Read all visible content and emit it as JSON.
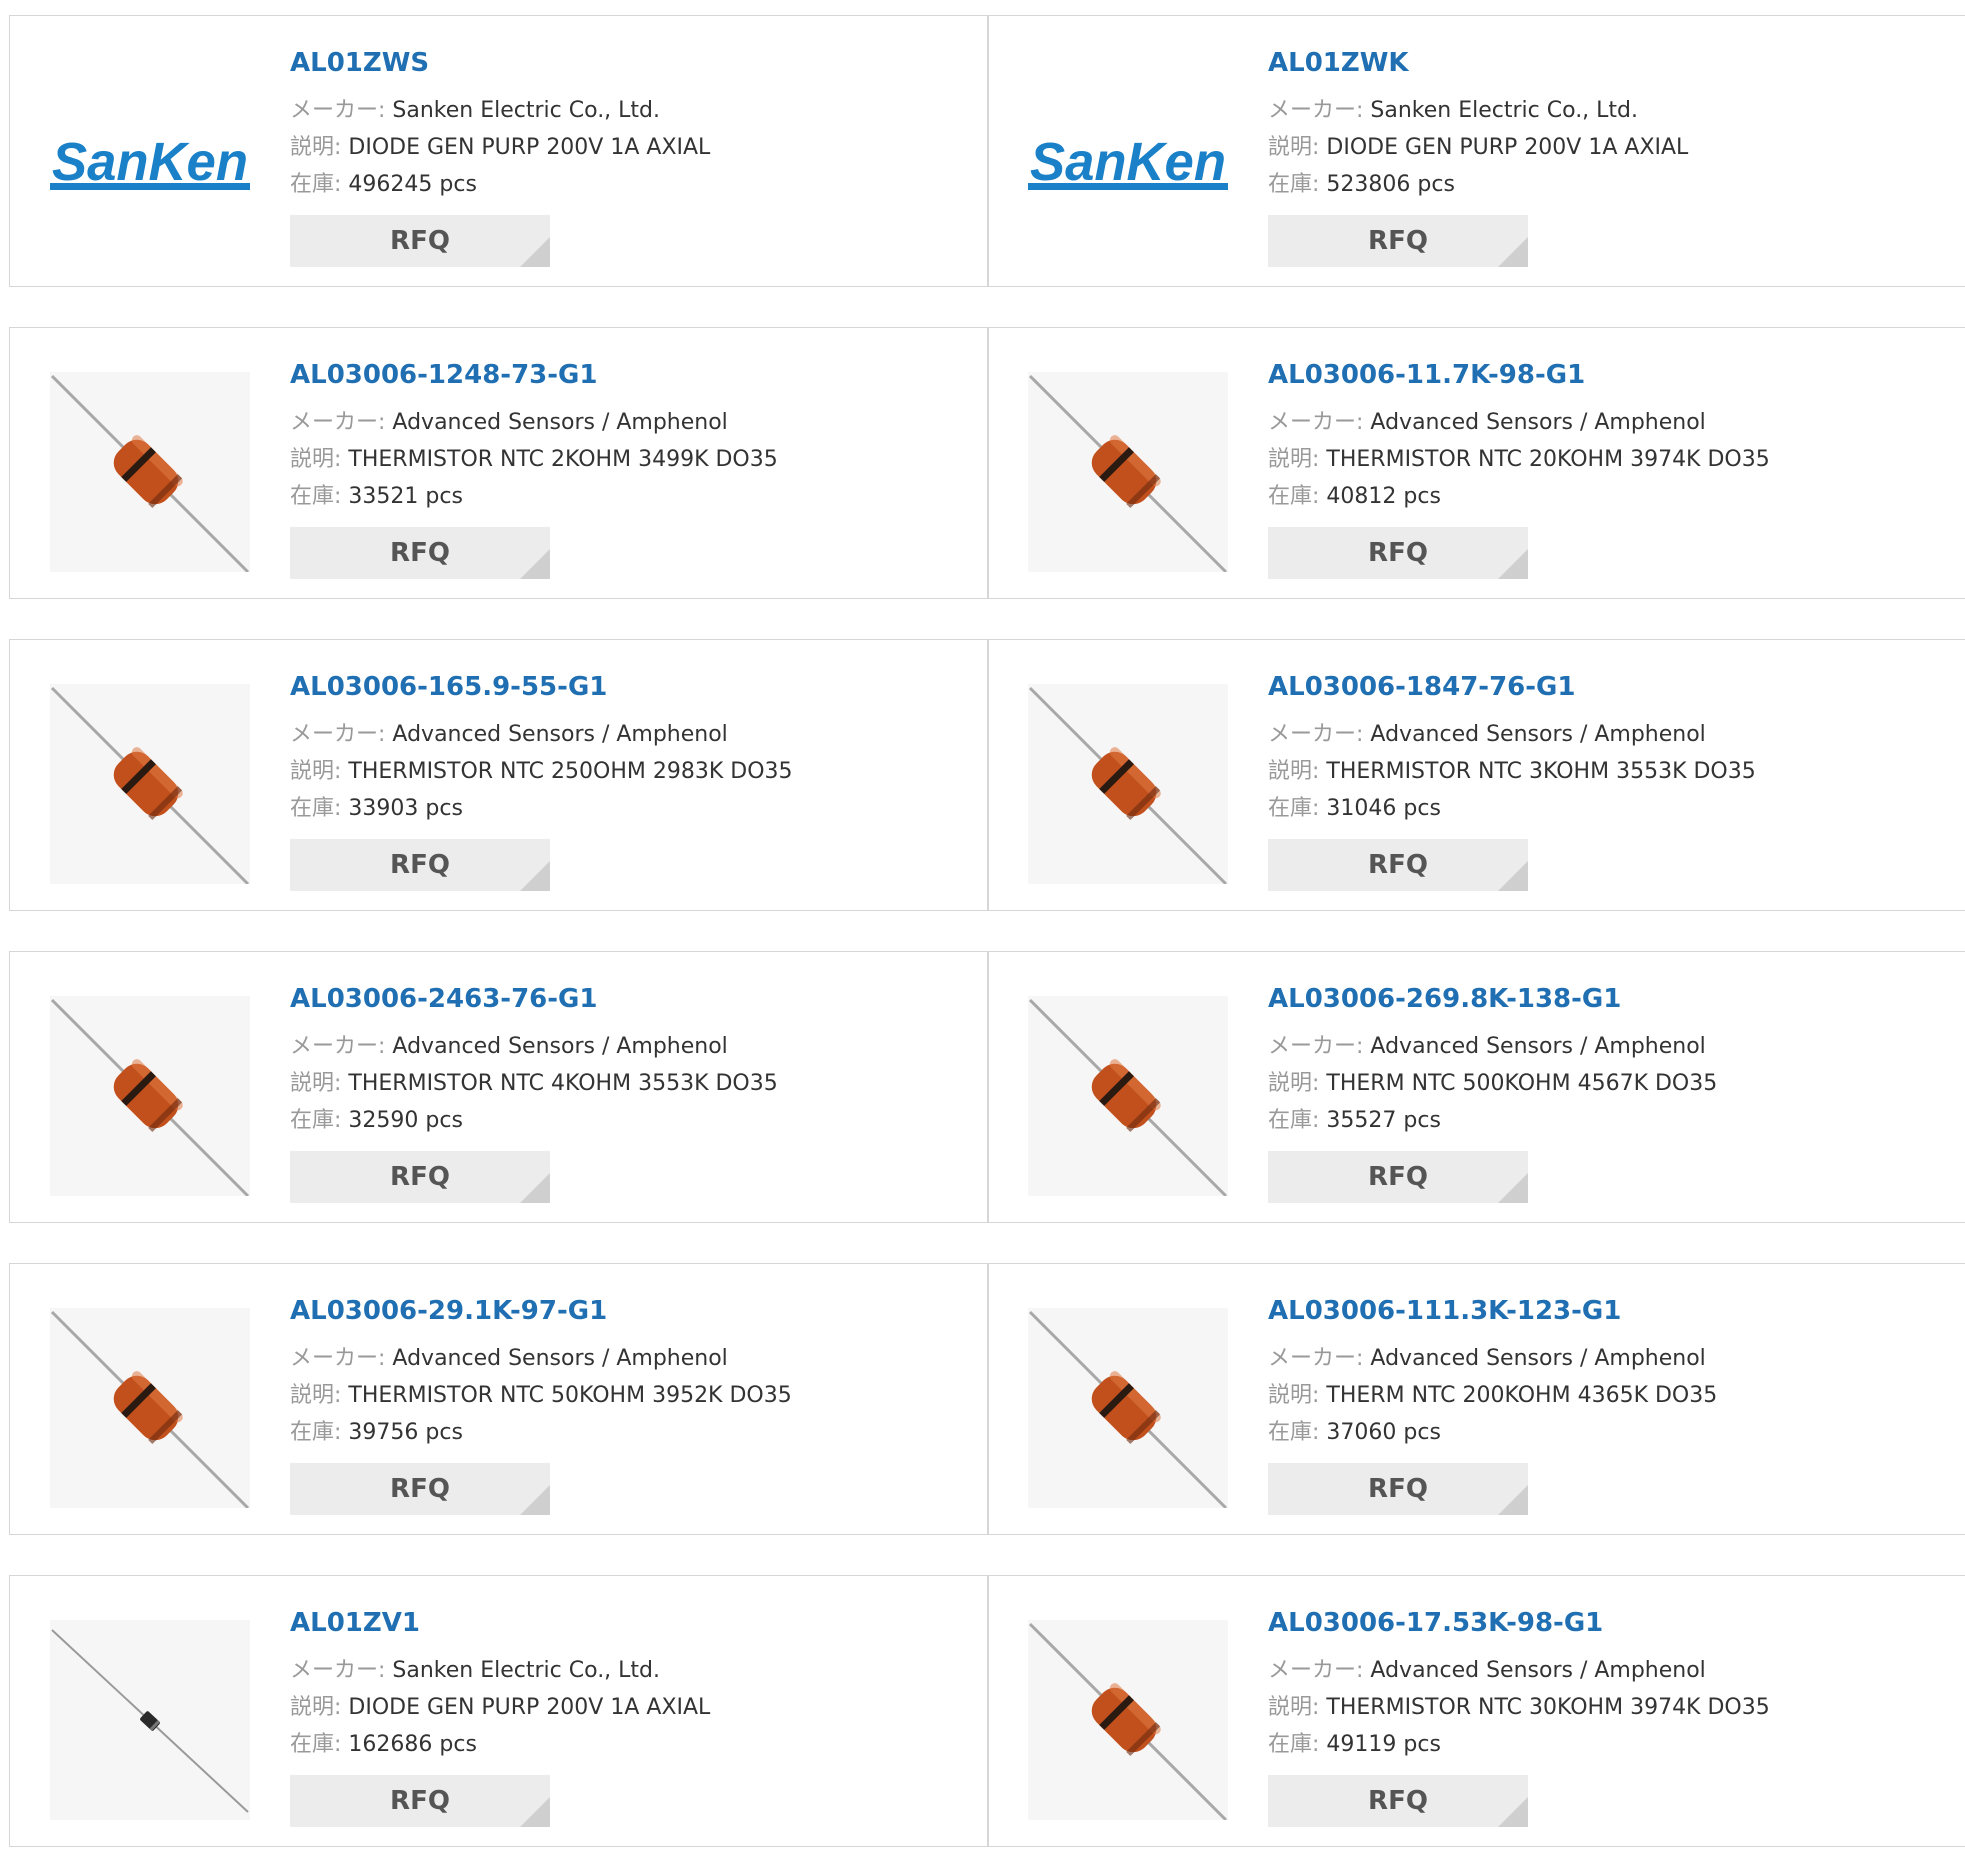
{
  "labels": {
    "maker": "メーカー:",
    "desc": "説明:",
    "stock": "在庫:",
    "rfq": "RFQ"
  },
  "colors": {
    "part_link": "#1f6fb2",
    "sanken_blue": "#1a80c8",
    "thermistor_body": "#c2501c"
  },
  "products": [
    {
      "part": "AL01ZWS",
      "maker": "Sanken Electric Co., Ltd.",
      "desc": "DIODE GEN PURP 200V 1A AXIAL",
      "stock": "496245 pcs",
      "image": "sanken-logo",
      "logo_text": "SanKen"
    },
    {
      "part": "AL01ZWK",
      "maker": "Sanken Electric Co., Ltd.",
      "desc": "DIODE GEN PURP 200V 1A AXIAL",
      "stock": "523806 pcs",
      "image": "sanken-logo",
      "logo_text": "SanKen"
    },
    {
      "part": "AL03006-1248-73-G1",
      "maker": "Advanced Sensors / Amphenol",
      "desc": "THERMISTOR NTC 2KOHM 3499K DO35",
      "stock": "33521 pcs",
      "image": "thermistor"
    },
    {
      "part": "AL03006-11.7K-98-G1",
      "maker": "Advanced Sensors / Amphenol",
      "desc": "THERMISTOR NTC 20KOHM 3974K DO35",
      "stock": "40812 pcs",
      "image": "thermistor"
    },
    {
      "part": "AL03006-165.9-55-G1",
      "maker": "Advanced Sensors / Amphenol",
      "desc": "THERMISTOR NTC 250OHM 2983K DO35",
      "stock": "33903 pcs",
      "image": "thermistor"
    },
    {
      "part": "AL03006-1847-76-G1",
      "maker": "Advanced Sensors / Amphenol",
      "desc": "THERMISTOR NTC 3KOHM 3553K DO35",
      "stock": "31046 pcs",
      "image": "thermistor"
    },
    {
      "part": "AL03006-2463-76-G1",
      "maker": "Advanced Sensors / Amphenol",
      "desc": "THERMISTOR NTC 4KOHM 3553K DO35",
      "stock": "32590 pcs",
      "image": "thermistor"
    },
    {
      "part": "AL03006-269.8K-138-G1",
      "maker": "Advanced Sensors / Amphenol",
      "desc": "THERM NTC 500KOHM 4567K DO35",
      "stock": "35527 pcs",
      "image": "thermistor"
    },
    {
      "part": "AL03006-29.1K-97-G1",
      "maker": "Advanced Sensors / Amphenol",
      "desc": "THERMISTOR NTC 50KOHM 3952K DO35",
      "stock": "39756 pcs",
      "image": "thermistor"
    },
    {
      "part": "AL03006-111.3K-123-G1",
      "maker": "Advanced Sensors / Amphenol",
      "desc": "THERM NTC 200KOHM 4365K DO35",
      "stock": "37060 pcs",
      "image": "thermistor"
    },
    {
      "part": "AL01ZV1",
      "maker": "Sanken Electric Co., Ltd.",
      "desc": "DIODE GEN PURP 200V 1A AXIAL",
      "stock": "162686 pcs",
      "image": "axial-diode"
    },
    {
      "part": "AL03006-17.53K-98-G1",
      "maker": "Advanced Sensors / Amphenol",
      "desc": "THERMISTOR NTC 30KOHM 3974K DO35",
      "stock": "49119 pcs",
      "image": "thermistor"
    }
  ]
}
